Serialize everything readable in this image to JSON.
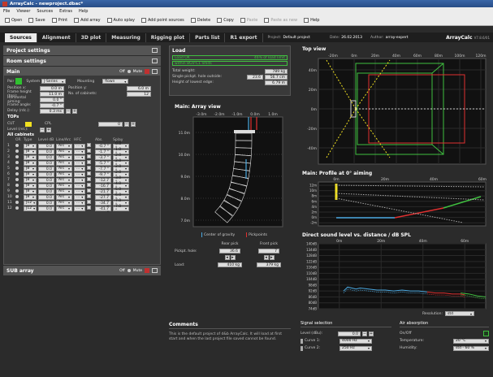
{
  "window": {
    "title": "ArrayCalc - newproject.dbac*"
  },
  "menu": [
    "File",
    "Viewer",
    "Sources",
    "Extras",
    "Help"
  ],
  "toolbar": [
    {
      "label": "Open",
      "icon": "folder-icon",
      "enabled": true
    },
    {
      "label": "Save",
      "icon": "save-icon",
      "enabled": true
    },
    {
      "label": "Print",
      "icon": "print-icon",
      "enabled": true
    },
    {
      "label": "Add array",
      "icon": "add-array-icon",
      "enabled": true
    },
    {
      "label": "Auto splay",
      "icon": "auto-splay-icon",
      "enabled": true
    },
    {
      "label": "Add point sources",
      "icon": "point-source-icon",
      "enabled": true
    },
    {
      "label": "Delete",
      "icon": "delete-icon",
      "enabled": true
    },
    {
      "label": "Copy",
      "icon": "copy-icon",
      "enabled": true
    },
    {
      "label": "Paste",
      "icon": "paste-icon",
      "enabled": false
    },
    {
      "label": "Paste as new",
      "icon": "paste-new-icon",
      "enabled": false
    },
    {
      "label": "Help",
      "icon": "help-icon",
      "enabled": true
    }
  ],
  "tabs": [
    "Sources",
    "Alignment",
    "3D plot",
    "Measuring",
    "Rigging plot",
    "Parts list",
    "R1 export"
  ],
  "active_tab": "Sources",
  "project": {
    "label": "Project:",
    "value": "Default project",
    "date_label": "Date:",
    "date": "26.02.2013",
    "author_label": "Author:",
    "author": "array-expert"
  },
  "logo": {
    "text": "ArrayCalc",
    "version": "V7.8.6/01"
  },
  "left": {
    "project_settings": "Project settings",
    "room_settings": "Room settings",
    "main_title": "Main",
    "off_label": "Off",
    "mute_label": "Mute",
    "pair_label": "Pair",
    "system_label": "System",
    "system_value": "J-Series",
    "mounting_label": "Mounting",
    "mounting_value": "flown",
    "position_x_label": "Position x:",
    "position_x": "0.0 m",
    "position_y_label": "Position y:",
    "position_y": "6.0 m",
    "frame_height_label": "Frame height (top):",
    "frame_height": "11.0 m",
    "num_cabinets_label": "No. of cabinets:",
    "num_cabinets": "12",
    "horizontal_aiming_label": "Horizontal aiming:",
    "horizontal_aiming": "0.0 °",
    "frame_angle_label": "Frame angle:",
    "frame_angle": "-0.7 °",
    "delay_label": "Delay (rdc.):",
    "delay": "0.3 ms",
    "tops_label": "TOPs",
    "cut_label": "CUT",
    "cpl_label": "CPL",
    "cpl_value": "0",
    "level_label": "Level (rel.):",
    "all_cabinets": "All cabinets",
    "col_headers": [
      "",
      "OR",
      "Type",
      "Level dB",
      "Line/Arc",
      "HFC",
      "",
      "Abs.",
      "Splay"
    ],
    "cabinets": [
      {
        "n": "1",
        "type": "J8",
        "level": "0.0",
        "la": "Arc",
        "hfc": "...",
        "abs": "-0.7 °",
        "splay": "0.0 °"
      },
      {
        "n": "2",
        "type": "J8",
        "level": "0.0",
        "la": "Arc",
        "hfc": "...",
        "abs": "-1.7 °",
        "splay": "1.0 °"
      },
      {
        "n": "3",
        "type": "J8",
        "level": "0.0",
        "la": "Arc",
        "hfc": "...",
        "abs": "-3.7 °",
        "splay": "2.0 °"
      },
      {
        "n": "4",
        "type": "J8",
        "level": "0.0",
        "la": "Arc",
        "hfc": "...",
        "abs": "-5.7 °",
        "splay": "2.0 °"
      },
      {
        "n": "5",
        "type": "J8",
        "level": "0.0",
        "la": "Arc",
        "hfc": "...",
        "abs": "-7.7 °",
        "splay": "2.0 °"
      },
      {
        "n": "6",
        "type": "J8",
        "level": "0.0",
        "la": "Arc",
        "hfc": "...",
        "abs": "-9.7 °",
        "splay": "2.0 °"
      },
      {
        "n": "7",
        "type": "J8",
        "level": "0.0",
        "la": "Arc",
        "hfc": "...",
        "abs": "-12.7 °",
        "splay": "3.0 °"
      },
      {
        "n": "8",
        "type": "J8",
        "level": "0.0",
        "la": "Arc",
        "hfc": "...",
        "abs": "-16.7 °",
        "splay": "4.0 °"
      },
      {
        "n": "9",
        "type": "J8",
        "level": "0.0",
        "la": "Arc",
        "hfc": "...",
        "abs": "-21.7 °",
        "splay": "5.0 °"
      },
      {
        "n": "10",
        "type": "J8",
        "level": "0.0",
        "la": "Arc",
        "hfc": "...",
        "abs": "-27.7 °",
        "splay": "6.0 °"
      },
      {
        "n": "11",
        "type": "J12",
        "level": "0.0",
        "la": "Arc",
        "hfc": "...",
        "abs": "-34.7 °",
        "splay": "7.0 °"
      },
      {
        "n": "12",
        "type": "J12",
        "level": "0.0",
        "la": "Arc",
        "hfc": "...",
        "abs": "-41.7 °",
        "splay": "7.0 °"
      }
    ],
    "sub_array": "SUB array"
  },
  "load": {
    "title": "Load",
    "load_ok": "Load OK",
    "load_pct": "46% of load limit",
    "bgv_ok": "within BGV-C1 limits",
    "total_weight_label": "Total weight:",
    "total_weight": "789 kg",
    "single_pickpt_label": "Single pickpt. hole outside:",
    "single_pickpt_a": "23.6",
    "single_pickpt_b": "56.7 cm",
    "height_lowest_label": "Height of lowest edge:",
    "height_lowest": "6.79 m"
  },
  "array_view": {
    "title": "Main: Array view",
    "x_ticks": [
      "-3.0m",
      "-2.0m",
      "-1.0m",
      "0.0m",
      "1.0m"
    ],
    "y_ticks": [
      "11.0m",
      "10.0m",
      "9.0m",
      "8.0m",
      "7.0m"
    ],
    "legend_cog": "Center of gravity",
    "legend_pick": "Pickpoints",
    "rear_pick": "Rear pick",
    "front_pick": "Front pick",
    "pickpt_hole_label": "Pickpt. hole:",
    "rear_hole": "36.6",
    "front_hole": "7",
    "load_label": "Load:",
    "rear_load": "410 kg",
    "front_load": "379 kg"
  },
  "comments": {
    "title": "Comments",
    "text": "This is the default project of d&b ArrayCalc. It will load at first start and when the last project file saved cannot be found."
  },
  "top_view": {
    "title": "Top view",
    "x_ticks": [
      "-20m",
      "0m",
      "20m",
      "40m",
      "60m",
      "80m",
      "100m",
      "120m"
    ],
    "y_ticks": [
      "40m",
      "20m",
      "0m",
      "-20m",
      "-40m"
    ]
  },
  "profile": {
    "title": "Main: Profile at 0° aiming",
    "x_ticks": [
      "0m",
      "20m",
      "40m",
      "60m"
    ],
    "y_ticks": [
      "12m",
      "10m",
      "8m",
      "6m",
      "4m",
      "2m",
      "0m",
      "-2m"
    ]
  },
  "chart_data": {
    "type": "line",
    "title": "Direct sound level vs. distance / dB SPL",
    "x_ticks": [
      "0m",
      "20m",
      "40m",
      "60m"
    ],
    "y_ticks": [
      "140dB",
      "134dB",
      "128dB",
      "122dB",
      "116dB",
      "110dB",
      "104dB",
      "98dB",
      "92dB",
      "86dB",
      "80dB",
      "74dB"
    ],
    "ylim": [
      74,
      140
    ],
    "series": [
      {
        "color": "#4aa8e0",
        "x": [
          2,
          4,
          6,
          8,
          10,
          14,
          18,
          22,
          26,
          30,
          34,
          38,
          42
        ],
        "y": [
          92,
          96,
          95,
          94,
          95,
          94,
          93,
          93,
          92,
          93,
          92,
          92,
          91
        ]
      },
      {
        "color": "#e03030",
        "x": [
          42,
          46,
          50,
          54,
          58,
          60
        ],
        "y": [
          91,
          90,
          90,
          89,
          89,
          88
        ]
      },
      {
        "color": "#40c040",
        "x": [
          58,
          62,
          66,
          70
        ],
        "y": [
          90,
          89,
          87,
          86
        ]
      }
    ]
  },
  "resolution": {
    "label": "Resolution:",
    "value": "std"
  },
  "signal": {
    "title": "Signal selection",
    "level_label": "Level (dBu):",
    "level": "0.0",
    "curve1_label": "Curve 1:",
    "curve1": "4000 Hz",
    "curve2_label": "Curve 2:",
    "curve2": "250 Hz"
  },
  "air": {
    "title": "Air absorption",
    "onoff_label": "On/Off",
    "temp_label": "Temperature:",
    "temp": "20 °C",
    "humidity_label": "Humidity:",
    "humidity": "std - 60 %"
  },
  "colors": {
    "accent": "#3a66a8",
    "green": "#40c040",
    "red": "#e03030",
    "blue": "#4aa8e0",
    "yellow": "#f0e020"
  }
}
